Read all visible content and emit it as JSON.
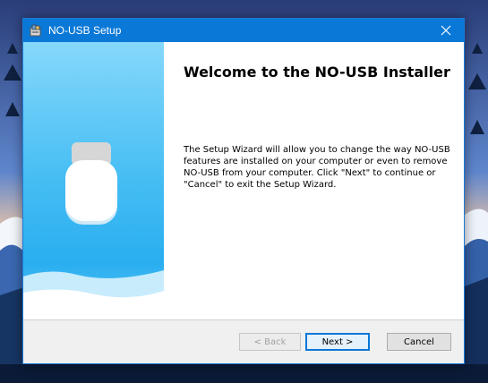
{
  "window": {
    "title": "NO-USB Setup",
    "heading": "Welcome to the NO-USB Installer",
    "description": "The Setup Wizard will allow you to change the way NO-USB features are installed on your computer or even to remove NO-USB from your computer.  Click \"Next\" to continue or \"Cancel\" to exit the Setup Wizard."
  },
  "buttons": {
    "back": "< Back",
    "next": "Next >",
    "cancel": "Cancel",
    "back_enabled": false
  },
  "icons": {
    "title": "installer-icon",
    "close": "close-icon",
    "banner": "usb-drive-icon"
  },
  "colors": {
    "titlebar": "#0a78d7",
    "banner": "#45bdf3",
    "accent": "#0a78d7"
  }
}
